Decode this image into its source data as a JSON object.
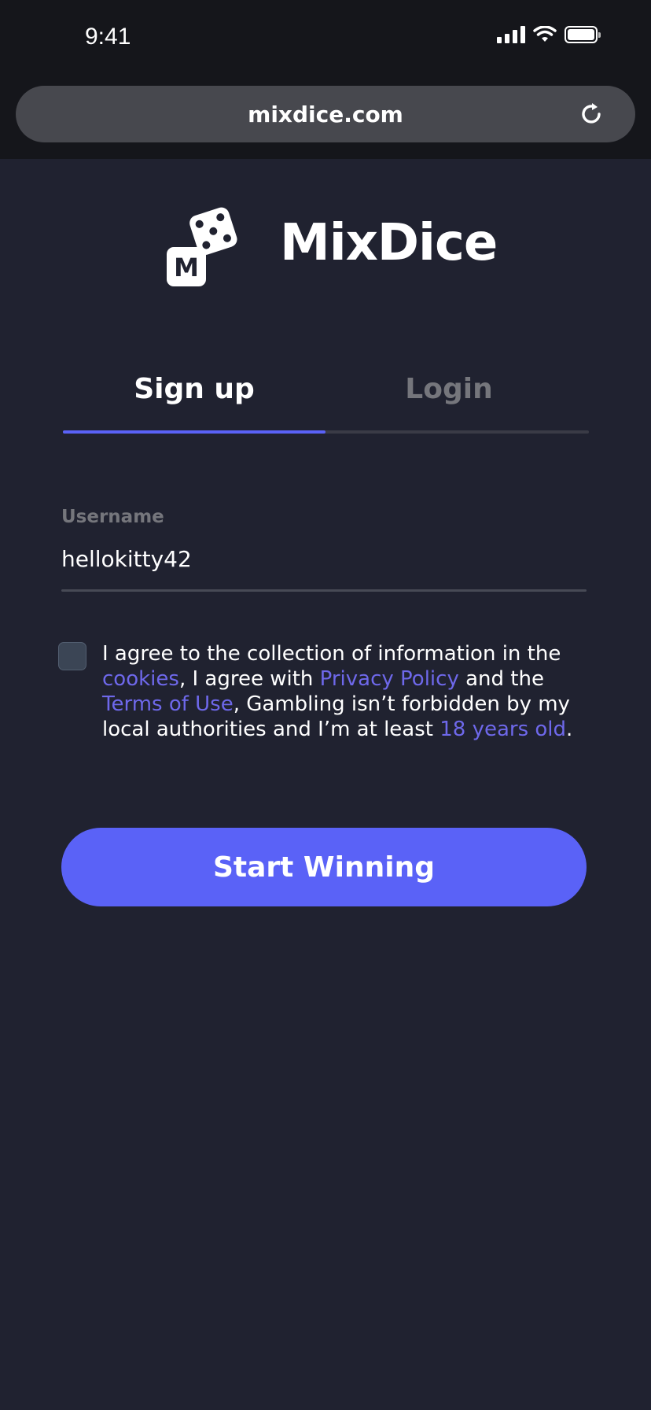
{
  "status_bar": {
    "time": "9:41",
    "icons": [
      "cellular-signal-icon",
      "wifi-icon",
      "battery-icon"
    ]
  },
  "browser": {
    "url": "mixdice.com",
    "reload_icon": "reload-icon"
  },
  "brand": {
    "name": "MixDice",
    "logo_letter": "M",
    "logo_icon": "dice-icon"
  },
  "tabs": [
    {
      "label": "Sign up",
      "active": true
    },
    {
      "label": "Login",
      "active": false
    }
  ],
  "form": {
    "username_label": "Username",
    "username_value": "hellokitty42",
    "consent_checked": false,
    "consent": {
      "part1": "I agree to the collection of information in the ",
      "link_cookies": "cookies",
      "part2": ", I agree with ",
      "link_privacy": "Privacy Policy",
      "part3": " and the ",
      "link_terms": "Terms of Use",
      "part4": ", Gambling isn’t forbidden by my local authorities and I’m at least ",
      "link_age": "18 years old",
      "part5": "."
    },
    "submit_label": "Start Winning"
  },
  "colors": {
    "background": "#202230",
    "chrome": "#15161b",
    "accent": "#5a62f7",
    "link": "#6e68ea",
    "muted": "#75767c"
  }
}
